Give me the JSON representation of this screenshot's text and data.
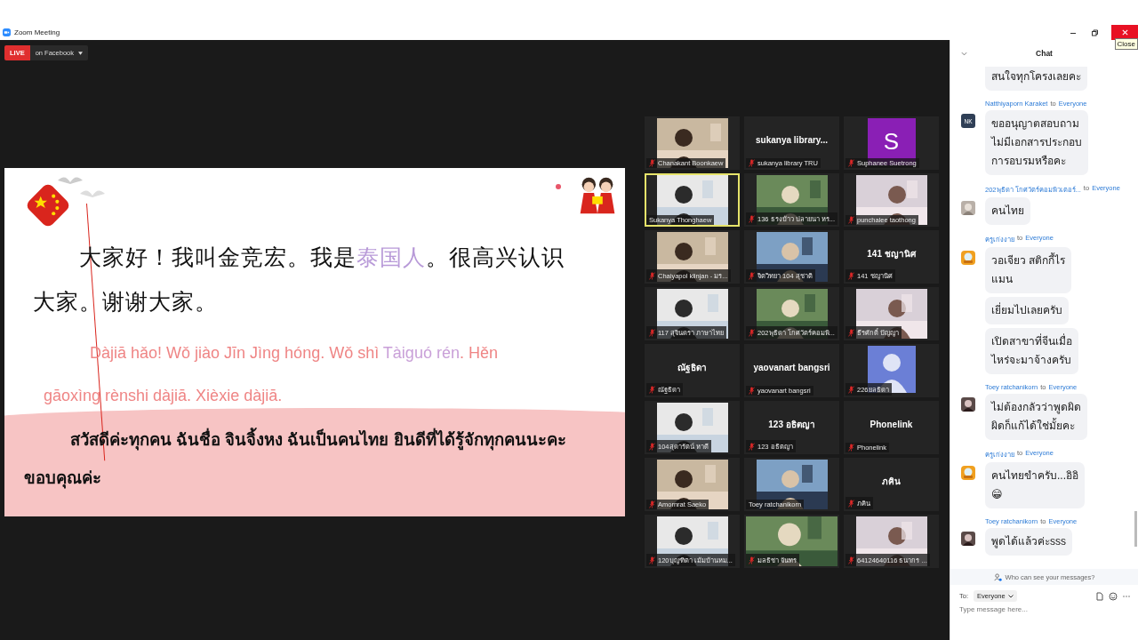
{
  "window": {
    "title": "Zoom Meeting",
    "close_tooltip": "Close"
  },
  "live": {
    "badge": "LIVE",
    "destination": "on Facebook"
  },
  "slide": {
    "chinese": [
      {
        "text": "大家好！我叫金竞宏。我是",
        "highlight": false
      },
      {
        "text": "泰国人",
        "highlight": true
      },
      {
        "text": "。很高兴认识大家。谢谢大家。",
        "highlight": false
      }
    ],
    "pinyin": [
      {
        "text": "Dàjiā hǎo! Wǒ jiào Jīn Jìng hóng. Wǒ shì ",
        "highlight": false
      },
      {
        "text": "Tàiguó rén",
        "highlight": true
      },
      {
        "text": ". Hěn gāoxìng rènshi dàjiā. Xièxie dàjiā.",
        "highlight": false
      }
    ],
    "thai": "สวัสดีค่ะทุกคน ฉันชื่อ จินจิ้งหง ฉันเป็นคนไทย ยินดีที่ได้รู้จักทุกคนนะคะ ขอบคุณค่ะ"
  },
  "participants": [
    {
      "kind": "picture",
      "name": "Chanakant Boonkaew",
      "muted": true,
      "speaking": false
    },
    {
      "kind": "name",
      "display": "sukanya  library...",
      "name": "sukanya library TRU",
      "muted": true,
      "speaking": false
    },
    {
      "kind": "letter",
      "letter": "S",
      "color": "#8a1fb5",
      "name": "Suphanee Suetrong",
      "muted": true,
      "speaking": false
    },
    {
      "kind": "picture",
      "name": "Sukanya Thonghaew",
      "muted": false,
      "speaking": true
    },
    {
      "kind": "picture",
      "name": "136 ธรงบ้าว ปลายนา หร...",
      "muted": true,
      "speaking": false
    },
    {
      "kind": "picture",
      "name": "punchalee taothong",
      "muted": true,
      "speaking": false
    },
    {
      "kind": "picture",
      "name": "Chaiyapol klinjan - มร...",
      "muted": true,
      "speaking": false
    },
    {
      "kind": "picture",
      "name": "จิตวิทยา 104 สุชาติ",
      "muted": true,
      "speaking": false
    },
    {
      "kind": "name",
      "display": "141 ชญานิศ",
      "name": "141 ชญานิศ",
      "muted": true,
      "speaking": false
    },
    {
      "kind": "picture",
      "name": "117 สุจินดรา ภาษาไทย",
      "muted": true,
      "speaking": false
    },
    {
      "kind": "picture",
      "name": "202พุธิดา โกศวัตร์คอมพิ...",
      "muted": true,
      "speaking": false
    },
    {
      "kind": "picture",
      "name": "ธีรศักดิ์ ปัญญา",
      "muted": true,
      "speaking": false
    },
    {
      "kind": "name",
      "display": "ณัฐธิดา",
      "name": "ณัฐธิดา",
      "muted": true,
      "speaking": false
    },
    {
      "kind": "name",
      "display": "yaovanart bangsri",
      "name": "yaovanart bangsri",
      "muted": true,
      "speaking": false
    },
    {
      "kind": "silhouette",
      "name": "226ยลธิดา",
      "muted": true,
      "speaking": false
    },
    {
      "kind": "picture",
      "name": "104สุดารัตน์ หาดี",
      "muted": true,
      "speaking": false
    },
    {
      "kind": "name",
      "display": "123 อธิตญา",
      "name": "123 อธิตญา",
      "muted": true,
      "speaking": false
    },
    {
      "kind": "name",
      "display": "Phonelink",
      "name": "Phonelink",
      "muted": true,
      "speaking": false
    },
    {
      "kind": "picture",
      "name": "Amornrat Saeko",
      "muted": true,
      "speaking": false
    },
    {
      "kind": "picture",
      "name": "Toey ratchanikorn",
      "muted": false,
      "speaking": false
    },
    {
      "kind": "name",
      "display": "ภคิน",
      "name": "ภคิน",
      "muted": true,
      "speaking": false
    },
    {
      "kind": "picture",
      "name": "120บุญฑิตา เม้มบ้านหม...",
      "muted": true,
      "speaking": false
    },
    {
      "kind": "picture",
      "name": "มลธิชา จันทร",
      "muted": true,
      "speaking": false
    },
    {
      "kind": "picture",
      "name": "64124640116 ธนากร ...",
      "muted": true,
      "speaking": false
    }
  ],
  "chat": {
    "title": "Chat",
    "messages": [
      {
        "bubbles": [
          "สนใจทุกโครงเลยคะ"
        ]
      },
      {
        "sender": "Natthiyaporn Karaket",
        "to": "to",
        "recipient": "Everyone",
        "avatar": {
          "kind": "initials",
          "text": "NK"
        },
        "bubbles": [
          "ขออนุญาตสอบถาม\nไม่มีเอกสารประกอบ\nการอบรมหรือคะ"
        ]
      },
      {
        "sender": "202พุธิดา โกศวัตร์คอมพิวเตอร์...",
        "to": "to",
        "recipient": "Everyone",
        "bubbles": [
          "คนไทย"
        ]
      },
      {
        "sender": "ครูเก่งงาย",
        "to": "to",
        "recipient": "Everyone",
        "avatar": {
          "kind": "cartoon"
        },
        "bubbles": [
          "วอเจียว สติกกี้ไร\nแมน",
          "เยี่ยมไปเลยครับ",
          "เปิดสาขาที่จีนเมื่อ\nไหร่จะมาจ้างครับ"
        ]
      },
      {
        "sender": "Toey ratchanikorn",
        "to": "to",
        "recipient": "Everyone",
        "bubbles": [
          "ไม่ต้องกลัวว่าพูดผิด\nผิดก็แก้ได้ใช่มั้ยคะ"
        ]
      },
      {
        "sender": "ครูเก่งงาย",
        "to": "to",
        "recipient": "Everyone",
        "avatar": {
          "kind": "cartoon"
        },
        "bubbles": [
          "คนไทยขำครับ...อิอิ\n😁"
        ]
      },
      {
        "sender": "Toey ratchanikorn",
        "to": "to",
        "recipient": "Everyone",
        "bubbles": [
          "พูดได้แล้วค่ะsss"
        ]
      }
    ],
    "privacy": "Who can see your messages?",
    "to_label": "To:",
    "to_value": "Everyone",
    "placeholder": "Type message here..."
  }
}
